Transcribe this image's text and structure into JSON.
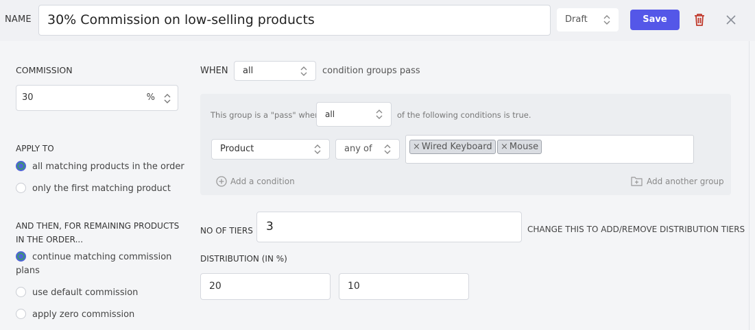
{
  "header": {
    "name_label": "NAME",
    "name_value": "30% Commission on low-selling products",
    "status": "Draft",
    "save_label": "Save"
  },
  "commission": {
    "label": "COMMISSION",
    "value": "30",
    "unit": "%"
  },
  "apply_to": {
    "label": "APPLY TO",
    "options": [
      {
        "label": "all matching products in the order",
        "selected": true
      },
      {
        "label": "only the first matching product",
        "selected": false
      }
    ]
  },
  "and_then": {
    "label": "AND THEN, FOR REMAINING PRODUCTS IN THE ORDER...",
    "options": [
      {
        "label": "continue matching commission plans",
        "selected": true
      },
      {
        "label": "use default commission",
        "selected": false
      },
      {
        "label": "apply zero commission",
        "selected": false
      }
    ]
  },
  "when": {
    "label": "WHEN",
    "value": "all",
    "suffix": "condition groups pass"
  },
  "group": {
    "prefix": "This group is a \"pass\" when",
    "value": "all",
    "suffix": "of the following conditions is true.",
    "condition": {
      "field": "Product",
      "operator": "any of",
      "tags": [
        "Wired Keyboard",
        "Mouse"
      ]
    },
    "add_condition": "Add a condition",
    "add_group": "Add another group"
  },
  "tiers": {
    "label": "NO OF TIERS",
    "value": "3",
    "help": "CHANGE THIS TO ADD/REMOVE DISTRIBUTION TIERS"
  },
  "distribution": {
    "label": "DISTRIBUTION (IN %)",
    "values": [
      "20",
      "10"
    ]
  },
  "colors": {
    "accent": "#5457e8",
    "danger": "#c0392b",
    "radio_selected": "#4e63d6"
  }
}
